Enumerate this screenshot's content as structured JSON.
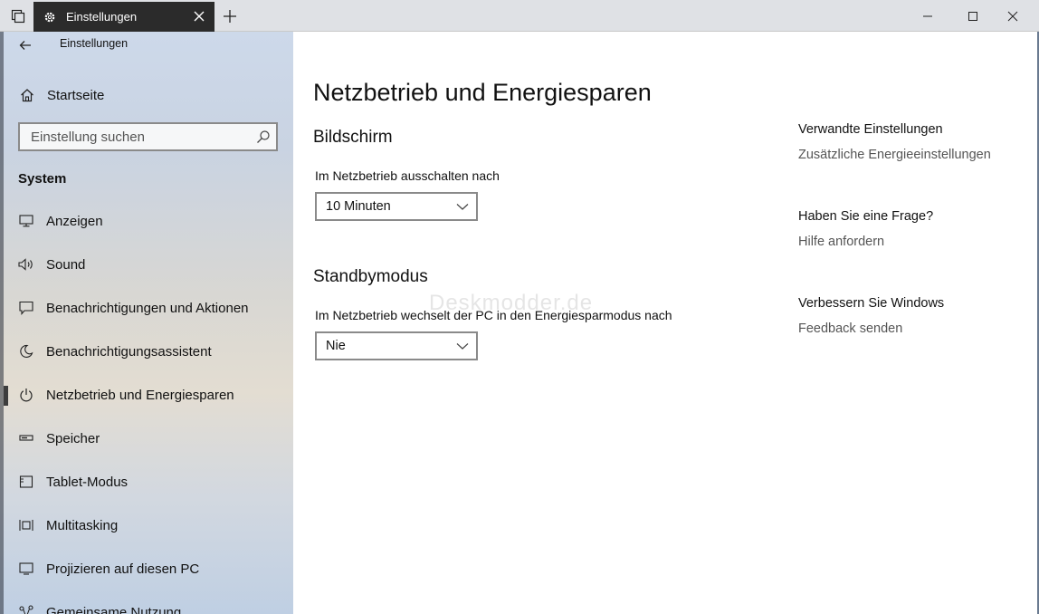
{
  "window": {
    "tab_title": "Einstellungen",
    "new_tab_symbol": "+"
  },
  "sidebar": {
    "app_title": "Einstellungen",
    "home_label": "Startseite",
    "search_placeholder": "Einstellung suchen",
    "section_title": "System",
    "items": [
      {
        "label": "Anzeigen",
        "icon": "monitor-icon"
      },
      {
        "label": "Sound",
        "icon": "speaker-icon"
      },
      {
        "label": "Benachrichtigungen und Aktionen",
        "icon": "notification-icon"
      },
      {
        "label": "Benachrichtigungsassistent",
        "icon": "moon-icon"
      },
      {
        "label": "Netzbetrieb und Energiesparen",
        "icon": "power-icon",
        "active": true
      },
      {
        "label": "Speicher",
        "icon": "storage-icon"
      },
      {
        "label": "Tablet-Modus",
        "icon": "tablet-icon"
      },
      {
        "label": "Multitasking",
        "icon": "multitasking-icon"
      },
      {
        "label": "Projizieren auf diesen PC",
        "icon": "project-icon"
      },
      {
        "label": "Gemeinsame Nutzung",
        "icon": "share-icon"
      }
    ]
  },
  "main": {
    "title": "Netzbetrieb und Energiesparen",
    "screen": {
      "heading": "Bildschirm",
      "label": "Im Netzbetrieb ausschalten nach",
      "value": "10 Minuten"
    },
    "sleep": {
      "heading": "Standbymodus",
      "label": "Im Netzbetrieb wechselt der PC in den Energiesparmodus nach",
      "value": "Nie"
    },
    "watermark": "Deskmodder.de"
  },
  "related": {
    "heading": "Verwandte Einstellungen",
    "link": "Zusätzliche Energieeinstellungen",
    "question_heading": "Haben Sie eine Frage?",
    "help_link": "Hilfe anfordern",
    "improve_heading": "Verbessern Sie Windows",
    "feedback_link": "Feedback senden"
  },
  "colors": {
    "active_bar": "#3d3d3d",
    "tab_bg": "#2b2b2b",
    "link": "#555555"
  }
}
